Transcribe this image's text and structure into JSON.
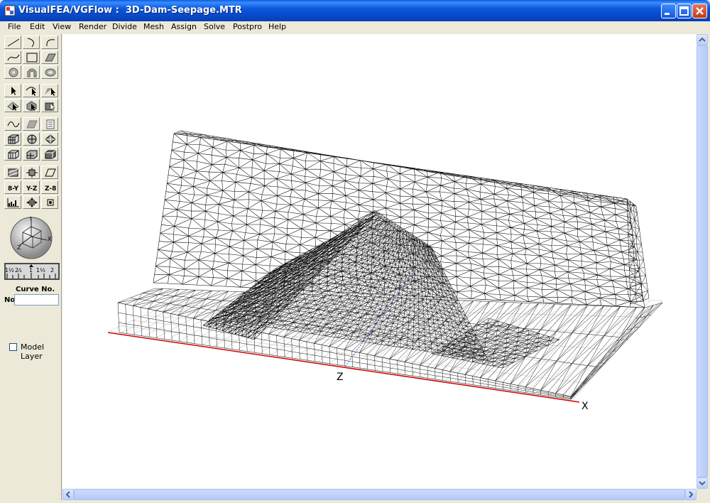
{
  "window": {
    "title": "VisualFEA/VGFlow :  3D-Dam-Seepage.MTR",
    "buttons": [
      "minimize",
      "maximize",
      "close"
    ]
  },
  "menu": {
    "items": [
      "File",
      "Edit",
      "View",
      "Render",
      "Divide",
      "Mesh",
      "Assign",
      "Solve",
      "Postpro",
      "Help"
    ]
  },
  "toolbox": {
    "ruler_marks": [
      "1½",
      "2⁄₃",
      "1",
      "1½",
      "2"
    ],
    "curve_label": "Curve No.",
    "no_label": "No",
    "no_value": "",
    "model_layer_label": "Model Layer",
    "model_layer_checked": false
  },
  "viewport": {
    "axis_x_label": "X",
    "axis_z_label": "Z",
    "compass_labels": {
      "y": "Y",
      "x": "X",
      "z": "Z"
    },
    "mesh_color": "#000000",
    "axis_x_color": "#d00000",
    "axis_z_color": "#3050c0"
  }
}
